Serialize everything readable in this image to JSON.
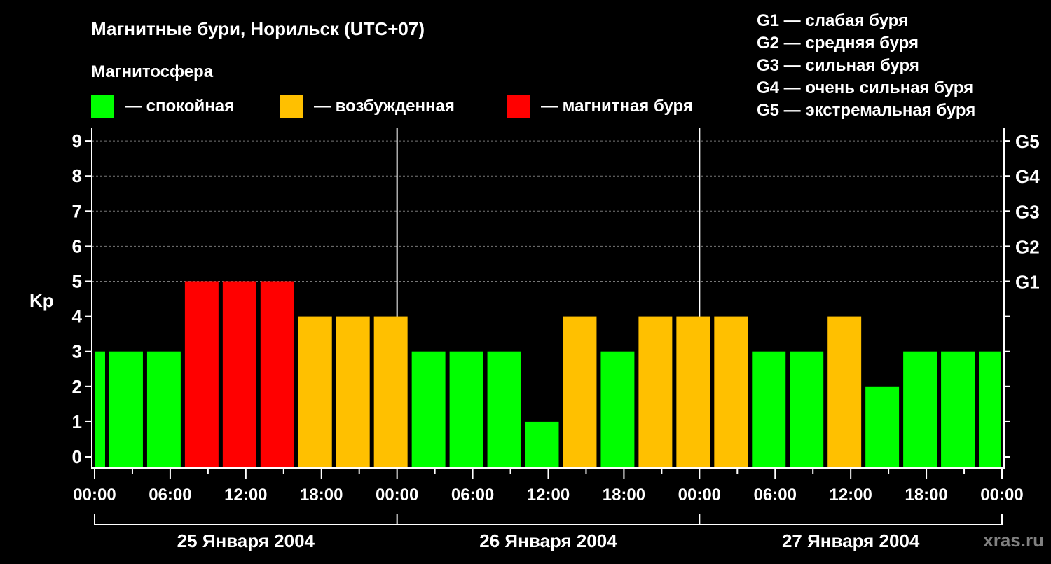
{
  "chart_data": {
    "type": "bar",
    "title": "Магнитные бури, Норильск (UTC+07)",
    "legend_title": "Магнитосфера",
    "legend": [
      {
        "label": "— спокойная",
        "color": "#00ff00"
      },
      {
        "label": "— возбужденная",
        "color": "#ffc000"
      },
      {
        "label": "— магнитная буря",
        "color": "#ff0000"
      }
    ],
    "g_scale": [
      "G1 — слабая буря",
      "G2 — средняя буря",
      "G3 — сильная буря",
      "G4 — очень сильная буря",
      "G5 — экстремальная буря"
    ],
    "ylabel": "Kp",
    "ylim": [
      0,
      9
    ],
    "y_ticks": [
      "0",
      "1",
      "2",
      "3",
      "4",
      "5",
      "6",
      "7",
      "8",
      "9"
    ],
    "right_ticks": [
      {
        "kp": 5,
        "label": "G1"
      },
      {
        "kp": 6,
        "label": "G2"
      },
      {
        "kp": 7,
        "label": "G3"
      },
      {
        "kp": 8,
        "label": "G4"
      },
      {
        "kp": 9,
        "label": "G5"
      }
    ],
    "x_ticks": [
      "00:00",
      "06:00",
      "12:00",
      "18:00",
      "00:00",
      "06:00",
      "12:00",
      "18:00",
      "00:00",
      "06:00",
      "12:00",
      "18:00",
      "00:00"
    ],
    "days": [
      "25 Января 2004",
      "26 Января 2004",
      "27 Января 2004"
    ],
    "bin_hours": 3,
    "first_bin_start_hour": -2,
    "kp_values": [
      3,
      3,
      3,
      5,
      5,
      5,
      4,
      4,
      4,
      3,
      3,
      3,
      1,
      4,
      3,
      4,
      4,
      4,
      3,
      3,
      4,
      2,
      3,
      3,
      3
    ],
    "kp_colors": [
      "g",
      "g",
      "g",
      "r",
      "r",
      "r",
      "y",
      "y",
      "y",
      "g",
      "g",
      "g",
      "g",
      "y",
      "g",
      "y",
      "y",
      "y",
      "g",
      "g",
      "y",
      "g",
      "g",
      "g",
      "g"
    ],
    "watermark": "xras.ru"
  }
}
